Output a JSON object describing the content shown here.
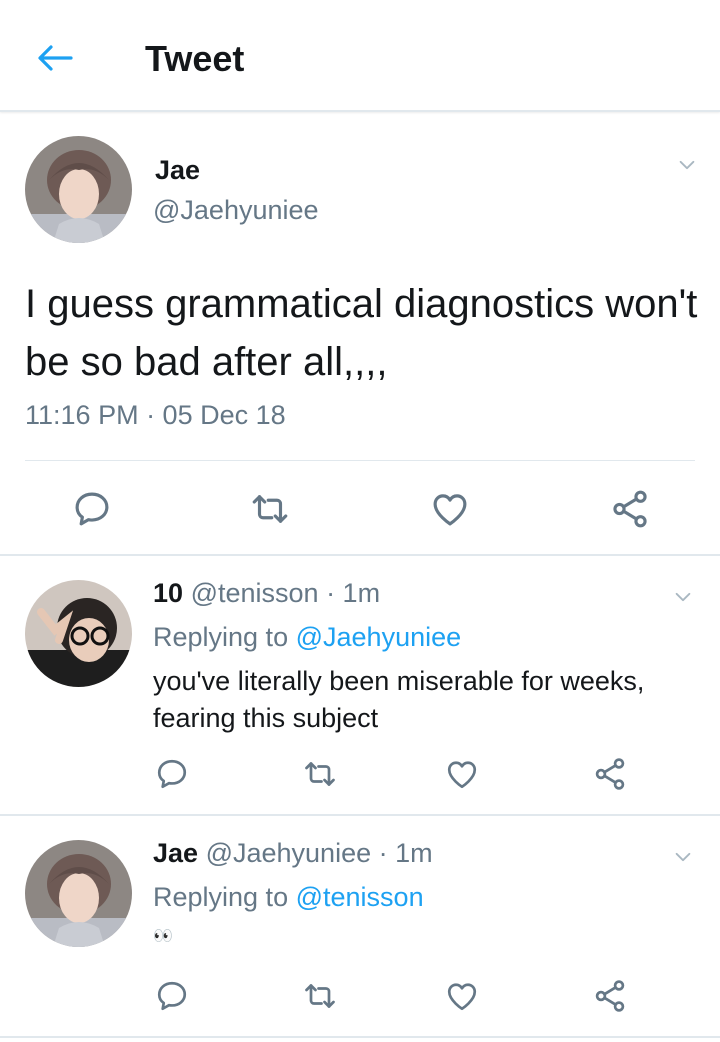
{
  "header": {
    "title": "Tweet",
    "back_icon": "back-arrow-icon",
    "accent": "#1da1f2"
  },
  "main_tweet": {
    "name": "Jae",
    "handle": "@Jaehyuniee",
    "text": "I guess grammatical diagnostics won't be so bad after all,,,,",
    "timestamp": "11:16 PM · 05 Dec 18"
  },
  "replies": [
    {
      "name": "10",
      "handle": "@tenisson",
      "time": "· 1m",
      "replying_prefix": "Replying to",
      "replying_to": "@Jaehyuniee",
      "text": "you've literally been miserable for weeks, fearing this subject"
    },
    {
      "name": "Jae",
      "handle": "@Jaehyuniee",
      "time": "· 1m",
      "replying_prefix": "Replying to",
      "replying_to": "@tenisson",
      "text": "👀"
    }
  ],
  "actions": [
    "reply-icon",
    "retweet-icon",
    "like-icon",
    "share-icon"
  ],
  "colors": {
    "text": "#14171a",
    "secondary": "#657786",
    "divider": "#e1e8ed",
    "icon": "#657786"
  }
}
